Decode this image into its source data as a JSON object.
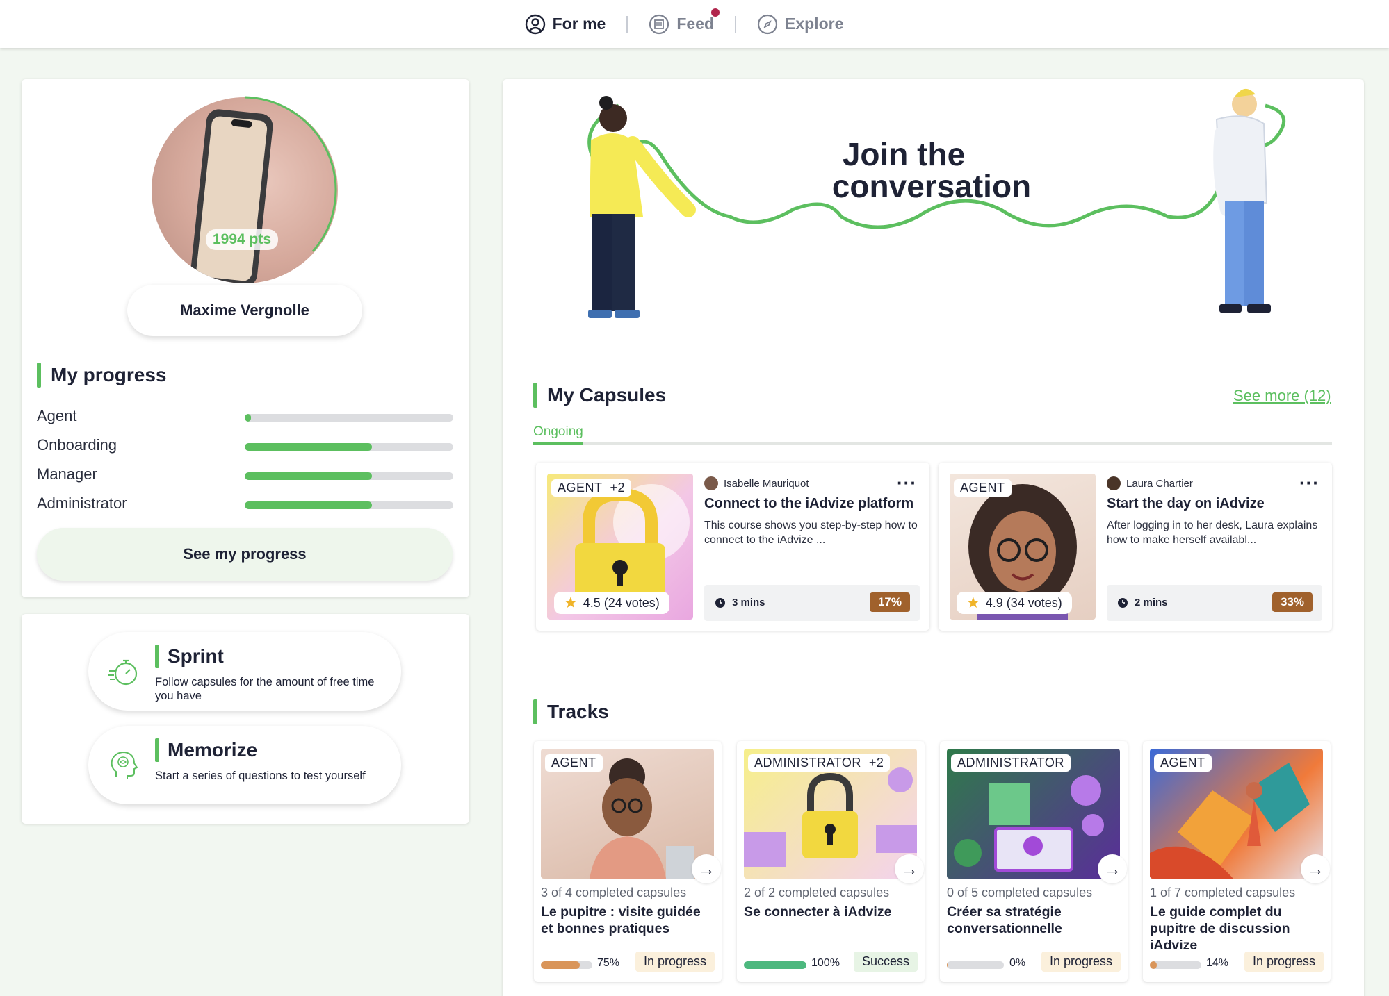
{
  "nav": {
    "items": [
      {
        "label": "For me",
        "icon": "user-circle-icon",
        "active": true
      },
      {
        "label": "Feed",
        "icon": "news-icon",
        "active": false,
        "has_notification": true
      },
      {
        "label": "Explore",
        "icon": "compass-icon",
        "active": false
      }
    ]
  },
  "profile": {
    "points": "1994 pts",
    "name": "Maxime Vergnolle"
  },
  "progress": {
    "title": "My progress",
    "rows": [
      {
        "label": "Agent",
        "value": 0.03
      },
      {
        "label": "Onboarding",
        "value": 0.61
      },
      {
        "label": "Manager",
        "value": 0.61
      },
      {
        "label": "Administrator",
        "value": 0.61
      }
    ],
    "button": "See my progress"
  },
  "modes": [
    {
      "title": "Sprint",
      "desc": "Follow capsules for the amount of free time you have",
      "icon": "stopwatch-icon"
    },
    {
      "title": "Memorize",
      "desc": "Start a series of questions to test yourself",
      "icon": "brain-head-icon"
    }
  ],
  "banner": {
    "line1": "Join the",
    "line2": "conversation"
  },
  "capsules": {
    "title": "My Capsules",
    "see_more": "See more (12)",
    "tab": "Ongoing",
    "items": [
      {
        "tag": "AGENT",
        "tag_extra": "+2",
        "rating": "4.5 (24 votes)",
        "author": "Isabelle Mauriquot",
        "title": "Connect to the iAdvize platform",
        "desc": "This course shows you step-by-step how to connect to the iAdvize ...",
        "duration": "3 mins",
        "percent": "17%"
      },
      {
        "tag": "AGENT",
        "tag_extra": "",
        "rating": "4.9 (34 votes)",
        "author": "Laura Chartier",
        "title": "Start the day on iAdvize",
        "desc": "After logging in to her desk, Laura explains how to make herself availabl...",
        "duration": "2 mins",
        "percent": "33%"
      }
    ]
  },
  "tracks": {
    "title": "Tracks",
    "items": [
      {
        "tag": "AGENT",
        "tag_extra": "",
        "count": "3 of 4 completed capsules",
        "title": "Le pupitre : visite guidée et bonnes pratiques",
        "percent_label": "75%",
        "progress": 0.75,
        "bar_color": "#d9955a",
        "status": "In progress",
        "status_type": "progress"
      },
      {
        "tag": "ADMINISTRATOR",
        "tag_extra": "+2",
        "count": "2 of 2 completed capsules",
        "title": "Se connecter à iAdvize",
        "percent_label": "100%",
        "progress": 1.0,
        "bar_color": "#4cb87e",
        "status": "Success",
        "status_type": "success"
      },
      {
        "tag": "ADMINISTRATOR",
        "tag_extra": "",
        "count": "0 of 5 completed capsules",
        "title": "Créer sa stratégie conversationnelle",
        "percent_label": "0%",
        "progress": 0.02,
        "bar_color": "#d9955a",
        "status": "In progress",
        "status_type": "progress"
      },
      {
        "tag": "AGENT",
        "tag_extra": "",
        "count": "1 of 7 completed capsules",
        "title": "Le guide complet du pupitre de discussion iAdvize",
        "percent_label": "14%",
        "progress": 0.14,
        "bar_color": "#d9955a",
        "status": "In progress",
        "status_type": "progress"
      }
    ]
  },
  "colors": {
    "accent": "#5cbf5f",
    "background": "#f2f7f1",
    "text": "#1e2235",
    "badge_brown": "#a0612c"
  }
}
